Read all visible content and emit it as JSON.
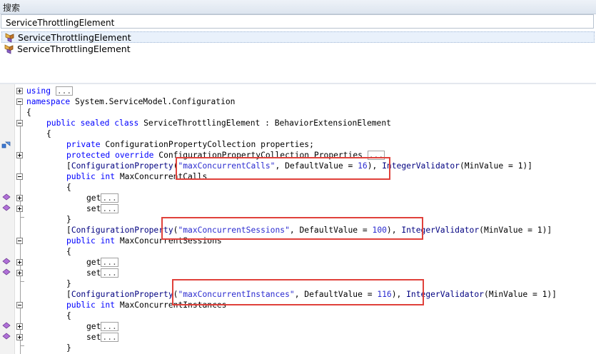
{
  "search": {
    "header": "搜索",
    "value": "ServiceThrottlingElement"
  },
  "results": [
    {
      "label": "ServiceThrottlingElement",
      "icon": "class-icon",
      "selected": true
    },
    {
      "label": "ServiceThrottlingElement",
      "icon": "class-icon",
      "selected": false
    }
  ],
  "code": {
    "using": {
      "kw": "using",
      "collapsed": "..."
    },
    "namespace": {
      "kw": "namespace",
      "name": "System.ServiceModel.Configuration"
    },
    "brace_open": "{",
    "class_decl": {
      "kw1": "public",
      "kw2": "sealed",
      "kw3": "class",
      "name": "ServiceThrottlingElement",
      "sep": " : ",
      "base": "BehaviorExtensionElement"
    },
    "brace_open2": "{",
    "field": {
      "kw": "private",
      "type": "ConfigurationPropertyCollection",
      "name": " properties;"
    },
    "prop_override": {
      "kw1": "protected",
      "kw2": "override",
      "type": "ConfigurationPropertyCollection",
      "name": " Properties",
      "collapsed": "..."
    },
    "attr1": {
      "open": "[",
      "attr": "ConfigurationProperty",
      "p1": "(",
      "str": "\"maxConcurrentCalls\"",
      "mid": ", DefaultValue = ",
      "num": "16",
      "p2": "), ",
      "attr2": "IntegerValidator",
      "rest": "(MinValue = 1)]"
    },
    "prop1": {
      "kw1": "public",
      "kw2": "int",
      "name": "MaxConcurrentCalls"
    },
    "brace_a1": "{",
    "get1": {
      "text": "get",
      "collapsed": "..."
    },
    "set1": {
      "text": "set",
      "collapsed": "..."
    },
    "brace_a2": "}",
    "attr2": {
      "open": "[",
      "attr": "ConfigurationProperty",
      "p1": "(",
      "str": "\"maxConcurrentSessions\"",
      "mid": ", DefaultValue = ",
      "num": "100",
      "p2": "), ",
      "attr2": "IntegerValidator",
      "rest": "(MinValue = 1)]"
    },
    "prop2": {
      "kw1": "public",
      "kw2": "int",
      "name": "MaxConcurrentSessions"
    },
    "brace_b1": "{",
    "get2": {
      "text": "get",
      "collapsed": "..."
    },
    "set2": {
      "text": "set",
      "collapsed": "..."
    },
    "brace_b2": "}",
    "attr3": {
      "open": "[",
      "attr": "ConfigurationProperty",
      "p1": "(",
      "str": "\"maxConcurrentInstances\"",
      "mid": ", DefaultValue = ",
      "num": "116",
      "p2": "), ",
      "attr2": "IntegerValidator",
      "rest": "(MinValue = 1)]"
    },
    "prop3": {
      "kw1": "public",
      "kw2": "int",
      "name": "MaxConcurrentInstances"
    },
    "brace_c1": "{",
    "get3": {
      "text": "get",
      "collapsed": "..."
    },
    "set3": {
      "text": "set",
      "collapsed": "..."
    },
    "brace_c2": "}"
  },
  "colors": {
    "highlight_box": "#e0413b",
    "keyword": "#0000ff",
    "type": "#2b91af",
    "string": "#a31515"
  }
}
